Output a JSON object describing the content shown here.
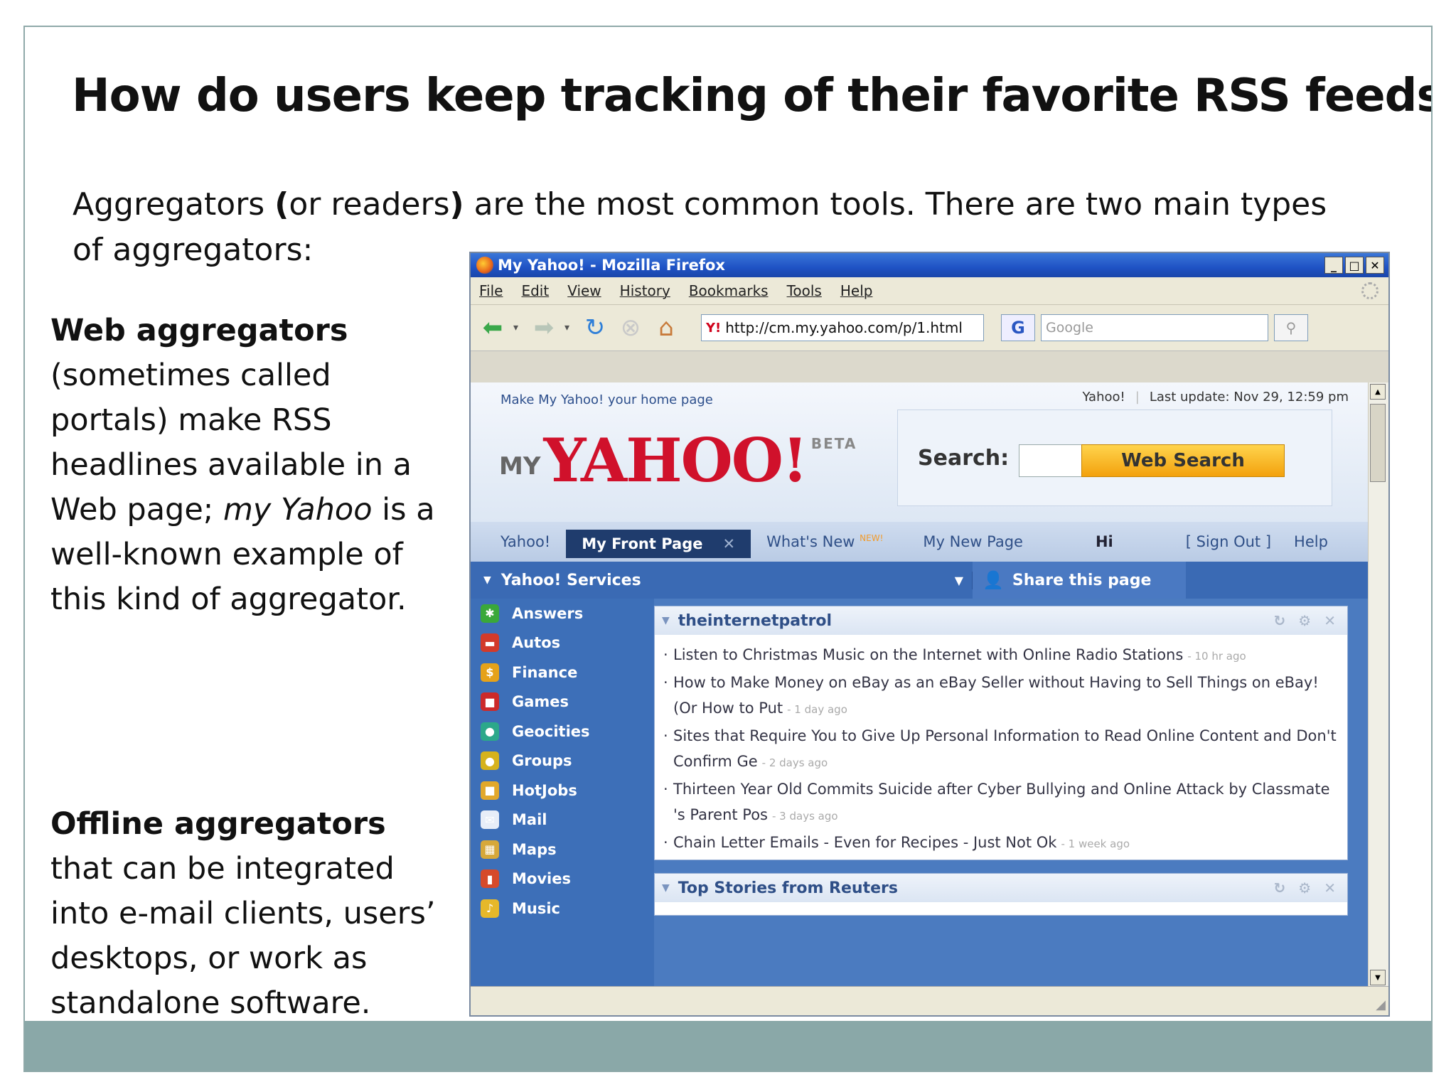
{
  "slide": {
    "title": "How do users keep tracking of their favorite RSS feeds?",
    "intro_part1": "Aggregators ",
    "intro_paren_open": "(",
    "intro_middle": "or readers",
    "intro_paren_close": ")",
    "intro_part2": " are the most common tools. There are two main types of aggregators:",
    "web_heading": "Web aggregators",
    "web_text1": " (sometimes called portals) make RSS headlines available in a Web page; ",
    "web_italic": "my Yahoo",
    "web_text2": " is a well-known example of this kind of aggregator.",
    "offline_heading": "Offline aggregators",
    "offline_text": " that can be integrated into e-mail clients, users’ desktops, or  work as standalone software.",
    "colors": {
      "frame": "#8fa9a9",
      "footer": "#8aa8a8"
    }
  },
  "browser": {
    "window_title": "My Yahoo! - Mozilla Firefox",
    "menu": [
      "File",
      "Edit",
      "View",
      "History",
      "Bookmarks",
      "Tools",
      "Help"
    ],
    "url": "http://cm.my.yahoo.com/p/1.html",
    "search_placeholder": "Google",
    "g_label": "G"
  },
  "yahoo": {
    "make_home": "Make My Yahoo! your home page",
    "yahoo_link": "Yahoo!",
    "last_update": "Last update: Nov 29, 12:59 pm",
    "logo_my": "MY",
    "logo_yahoo": "YAHOO!",
    "logo_beta": "BETA",
    "search_label": "Search:",
    "web_search": "Web Search",
    "tabs": {
      "yahoo": "Yahoo!",
      "front": "My Front Page",
      "whats_new": "What's New",
      "new_badge": "NEW!",
      "my_new_page": "My New Page",
      "hi": "Hi",
      "sign_out": "[ Sign Out ]",
      "help": "Help"
    },
    "services_label": "Yahoo! Services",
    "share_label": "Share this page",
    "services": [
      {
        "label": "Answers",
        "color": "#3aa83a",
        "glyph": "✱"
      },
      {
        "label": "Autos",
        "color": "#d23a2a",
        "glyph": "▬"
      },
      {
        "label": "Finance",
        "color": "#e6a21a",
        "glyph": "$"
      },
      {
        "label": "Games",
        "color": "#cc2a2a",
        "glyph": "■"
      },
      {
        "label": "Geocities",
        "color": "#2ca88a",
        "glyph": "●"
      },
      {
        "label": "Groups",
        "color": "#d6b21c",
        "glyph": "●"
      },
      {
        "label": "HotJobs",
        "color": "#e2a82a",
        "glyph": "■"
      },
      {
        "label": "Mail",
        "color": "#e8eef8",
        "glyph": "✉"
      },
      {
        "label": "Maps",
        "color": "#d6a83a",
        "glyph": "▦"
      },
      {
        "label": "Movies",
        "color": "#d64a2a",
        "glyph": "▮"
      },
      {
        "label": "Music",
        "color": "#e6b82a",
        "glyph": "♪"
      }
    ],
    "module1": {
      "title": "theinternetpatrol",
      "items": [
        {
          "text": "Listen to Christmas Music on the Internet with Online Radio Stations",
          "age": "- 10 hr ago"
        },
        {
          "text": "How to Make Money on eBay as an eBay Seller without Having to Sell Things on eBay! (Or How to Put",
          "age": "- 1 day ago"
        },
        {
          "text": "Sites that Require You to Give Up Personal Information to Read Online Content and Don't Confirm Ge",
          "age": "- 2 days ago"
        },
        {
          "text": "Thirteen Year Old Commits Suicide after Cyber Bullying and Online Attack by Classmate 's Parent Pos",
          "age": "- 3 days ago"
        },
        {
          "text": "Chain Letter Emails - Even for Recipes - Just Not Ok",
          "age": "- 1 week ago"
        }
      ]
    },
    "module2": {
      "title": "Top Stories from Reuters"
    }
  }
}
